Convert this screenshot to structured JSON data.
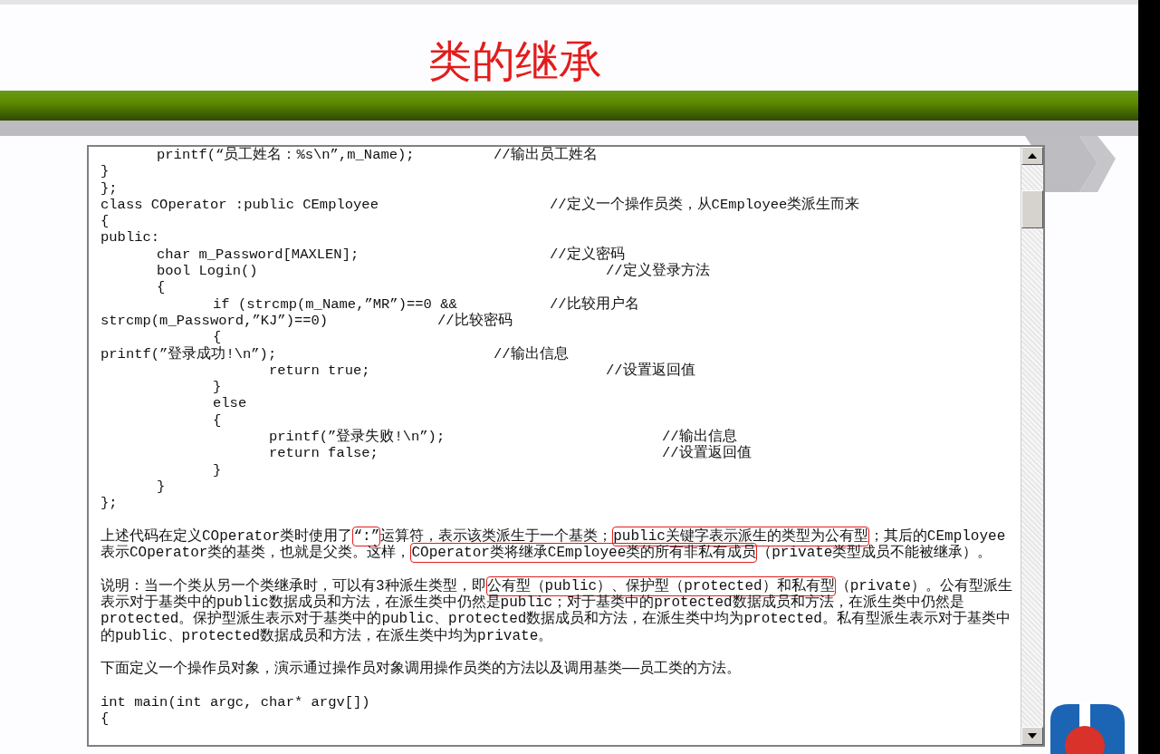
{
  "slide": {
    "title": "类的继承"
  },
  "document": {
    "code_top": [
      "\tprintf(“员工姓名：%s\\n”,m_Name);\t\t//输出员工姓名",
      "}",
      "};",
      "class COperator :public CEmployee\t\t\t//定义一个操作员类，从CEmployee类派生而来",
      "{",
      "public:",
      "\tchar m_Password[MAXLEN];\t\t\t\t//定义密码",
      "\tbool Login()\t\t\t\t\t\t\t//定义登录方法",
      "\t{",
      "\t\tif (strcmp(m_Name,”MR”)==0 &&\t\t//比较用户名",
      "strcmp(m_Password,”KJ”)==0)\t\t//比较密码",
      "\t\t{",
      "printf(”登录成功!\\n”);\t\t\t\t//输出信息",
      "\t\t\treturn true;\t\t\t\t\t//设置返回值",
      "\t\t}",
      "\t\telse",
      "\t\t{",
      "\t\t\tprintf(”登录失败!\\n”);\t\t\t\t//输出信息",
      "\t\t\treturn false;\t\t\t\t\t//设置返回值",
      "\t\t}",
      "\t}",
      "};"
    ],
    "paragraphs": [
      [
        {
          "text": "上述代码在定义COperator类时使用了",
          "boxed": false
        },
        {
          "text": "“:”",
          "boxed": true
        },
        {
          "text": "运算符，表示该类派生于一个基类；",
          "boxed": false
        },
        {
          "text": "public关键字表示派生的类型为公有型",
          "boxed": true
        },
        {
          "text": "；其后的CEmployee表示COperator类的基类，也就是父类。这样，",
          "boxed": false
        },
        {
          "text": "COperator类将继承CEmployee类的所有非私有成员",
          "boxed": true
        },
        {
          "text": "（private类型成员不能被继承）。",
          "boxed": false
        }
      ],
      [
        {
          "text": "说明：当一个类从另一个类继承时，可以有3种派生类型，即",
          "boxed": false
        },
        {
          "text": "公有型（public）、保护型（protected）和私有型",
          "boxed": true
        },
        {
          "text": "（private）。公有型派生表示对于基类中的public数据成员和方法，在派生类中仍然是public；对于基类中的protected数据成员和方法，在派生类中仍然是protected。保护型派生表示对于基类中的public、protected数据成员和方法，在派生类中均为protected。私有型派生表示对于基类中的public、protected数据成员和方法，在派生类中均为private。",
          "boxed": false
        }
      ],
      [
        {
          "text": "下面定义一个操作员对象，演示通过操作员对象调用操作员类的方法以及调用基类——员工类的方法。",
          "boxed": false
        }
      ]
    ],
    "code_bottom": [
      "int main(int argc, char* argv[])",
      "{"
    ]
  }
}
